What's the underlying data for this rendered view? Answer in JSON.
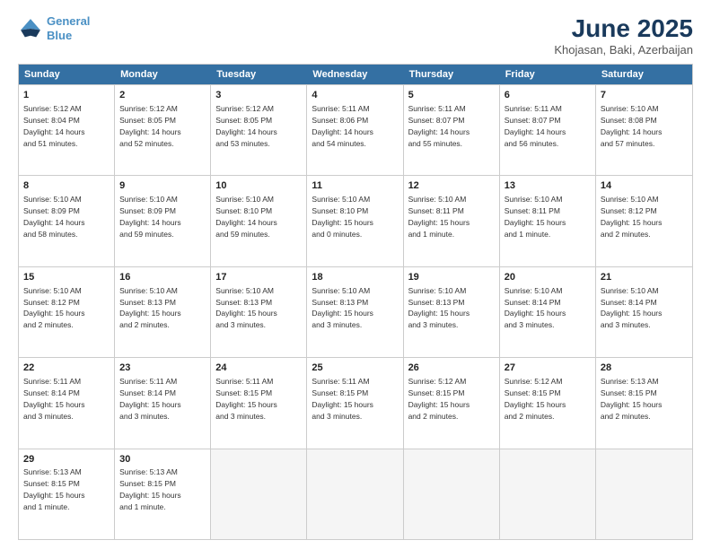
{
  "logo": {
    "line1": "General",
    "line2": "Blue"
  },
  "title": "June 2025",
  "subtitle": "Khojasan, Baki, Azerbaijan",
  "days": [
    "Sunday",
    "Monday",
    "Tuesday",
    "Wednesday",
    "Thursday",
    "Friday",
    "Saturday"
  ],
  "rows": [
    [
      {
        "day": "1",
        "sunrise": "5:12 AM",
        "sunset": "8:04 PM",
        "daylight": "14 hours and 51 minutes."
      },
      {
        "day": "2",
        "sunrise": "5:12 AM",
        "sunset": "8:05 PM",
        "daylight": "14 hours and 52 minutes."
      },
      {
        "day": "3",
        "sunrise": "5:12 AM",
        "sunset": "8:05 PM",
        "daylight": "14 hours and 53 minutes."
      },
      {
        "day": "4",
        "sunrise": "5:11 AM",
        "sunset": "8:06 PM",
        "daylight": "14 hours and 54 minutes."
      },
      {
        "day": "5",
        "sunrise": "5:11 AM",
        "sunset": "8:07 PM",
        "daylight": "14 hours and 55 minutes."
      },
      {
        "day": "6",
        "sunrise": "5:11 AM",
        "sunset": "8:07 PM",
        "daylight": "14 hours and 56 minutes."
      },
      {
        "day": "7",
        "sunrise": "5:10 AM",
        "sunset": "8:08 PM",
        "daylight": "14 hours and 57 minutes."
      }
    ],
    [
      {
        "day": "8",
        "sunrise": "5:10 AM",
        "sunset": "8:09 PM",
        "daylight": "14 hours and 58 minutes."
      },
      {
        "day": "9",
        "sunrise": "5:10 AM",
        "sunset": "8:09 PM",
        "daylight": "14 hours and 59 minutes."
      },
      {
        "day": "10",
        "sunrise": "5:10 AM",
        "sunset": "8:10 PM",
        "daylight": "14 hours and 59 minutes."
      },
      {
        "day": "11",
        "sunrise": "5:10 AM",
        "sunset": "8:10 PM",
        "daylight": "15 hours and 0 minutes."
      },
      {
        "day": "12",
        "sunrise": "5:10 AM",
        "sunset": "8:11 PM",
        "daylight": "15 hours and 1 minute."
      },
      {
        "day": "13",
        "sunrise": "5:10 AM",
        "sunset": "8:11 PM",
        "daylight": "15 hours and 1 minute."
      },
      {
        "day": "14",
        "sunrise": "5:10 AM",
        "sunset": "8:12 PM",
        "daylight": "15 hours and 2 minutes."
      }
    ],
    [
      {
        "day": "15",
        "sunrise": "5:10 AM",
        "sunset": "8:12 PM",
        "daylight": "15 hours and 2 minutes."
      },
      {
        "day": "16",
        "sunrise": "5:10 AM",
        "sunset": "8:13 PM",
        "daylight": "15 hours and 2 minutes."
      },
      {
        "day": "17",
        "sunrise": "5:10 AM",
        "sunset": "8:13 PM",
        "daylight": "15 hours and 3 minutes."
      },
      {
        "day": "18",
        "sunrise": "5:10 AM",
        "sunset": "8:13 PM",
        "daylight": "15 hours and 3 minutes."
      },
      {
        "day": "19",
        "sunrise": "5:10 AM",
        "sunset": "8:13 PM",
        "daylight": "15 hours and 3 minutes."
      },
      {
        "day": "20",
        "sunrise": "5:10 AM",
        "sunset": "8:14 PM",
        "daylight": "15 hours and 3 minutes."
      },
      {
        "day": "21",
        "sunrise": "5:10 AM",
        "sunset": "8:14 PM",
        "daylight": "15 hours and 3 minutes."
      }
    ],
    [
      {
        "day": "22",
        "sunrise": "5:11 AM",
        "sunset": "8:14 PM",
        "daylight": "15 hours and 3 minutes."
      },
      {
        "day": "23",
        "sunrise": "5:11 AM",
        "sunset": "8:14 PM",
        "daylight": "15 hours and 3 minutes."
      },
      {
        "day": "24",
        "sunrise": "5:11 AM",
        "sunset": "8:15 PM",
        "daylight": "15 hours and 3 minutes."
      },
      {
        "day": "25",
        "sunrise": "5:11 AM",
        "sunset": "8:15 PM",
        "daylight": "15 hours and 3 minutes."
      },
      {
        "day": "26",
        "sunrise": "5:12 AM",
        "sunset": "8:15 PM",
        "daylight": "15 hours and 2 minutes."
      },
      {
        "day": "27",
        "sunrise": "5:12 AM",
        "sunset": "8:15 PM",
        "daylight": "15 hours and 2 minutes."
      },
      {
        "day": "28",
        "sunrise": "5:13 AM",
        "sunset": "8:15 PM",
        "daylight": "15 hours and 2 minutes."
      }
    ],
    [
      {
        "day": "29",
        "sunrise": "5:13 AM",
        "sunset": "8:15 PM",
        "daylight": "15 hours and 1 minute."
      },
      {
        "day": "30",
        "sunrise": "5:13 AM",
        "sunset": "8:15 PM",
        "daylight": "15 hours and 1 minute."
      },
      null,
      null,
      null,
      null,
      null
    ]
  ]
}
